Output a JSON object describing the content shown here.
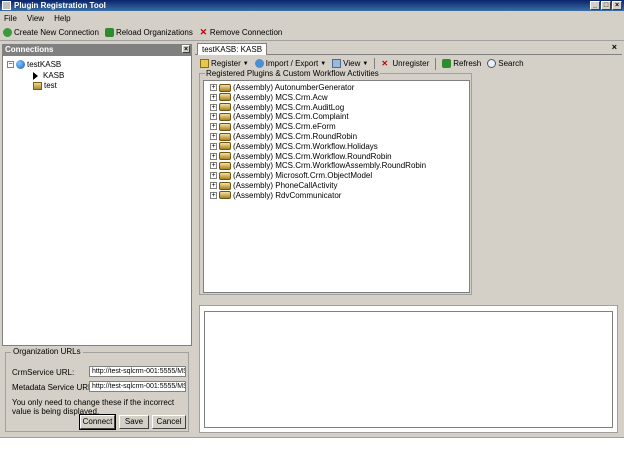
{
  "window": {
    "title": "Plugin Registration Tool"
  },
  "menu": {
    "items": [
      "File",
      "View",
      "Help"
    ]
  },
  "toolbar": {
    "create_label": "Create New Connection",
    "reload_label": "Reload Organizations",
    "remove_label": "Remove Connection"
  },
  "connections": {
    "header": "Connections",
    "tree": {
      "root": "testKASB",
      "children": [
        "KASB",
        "test"
      ]
    }
  },
  "org_urls": {
    "legend": "Organization URLs",
    "cm_label": "CrmService URL:",
    "cm_value": "http://test-sqlcrm-001:5555/MS",
    "meta_label": "Metadata Service URL:",
    "meta_value": "http://test-sqlcrm-001:5555/MS",
    "note": "You only need to change these if the incorrect value is being displayed.",
    "connect": "Connect",
    "save": "Save",
    "cancel": "Cancel"
  },
  "tab": {
    "label": "testKASB: KASB"
  },
  "rtoolbar": {
    "register": "Register",
    "import_export": "Import / Export",
    "view": "View",
    "unregister": "Unregister",
    "refresh": "Refresh",
    "search": "Search"
  },
  "registered": {
    "legend": "Registered Plugins & Custom Workflow Activities",
    "items": [
      "(Assembly) AutonumberGenerator",
      "(Assembly) MCS.Crm.Acw",
      "(Assembly) MCS.Crm.AuditLog",
      "(Assembly) MCS.Crm.Complaint",
      "(Assembly) MCS.Crm.eForm",
      "(Assembly) MCS.Crm.RoundRobin",
      "(Assembly) MCS.Crm.Workflow.Holidays",
      "(Assembly) MCS.Crm.Workflow.RoundRobin",
      "(Assembly) MCS.Crm.WorkflowAssembly.RoundRobin",
      "(Assembly) Microsoft.Crm.ObjectModel",
      "(Assembly) PhoneCallActivity",
      "(Assembly) RdvCommunicator"
    ]
  },
  "colors": {
    "title_bar": "#0a246a",
    "chrome": "#d4d0c8",
    "accent_green": "#3b9a3b",
    "remove_red": "#c00000"
  }
}
